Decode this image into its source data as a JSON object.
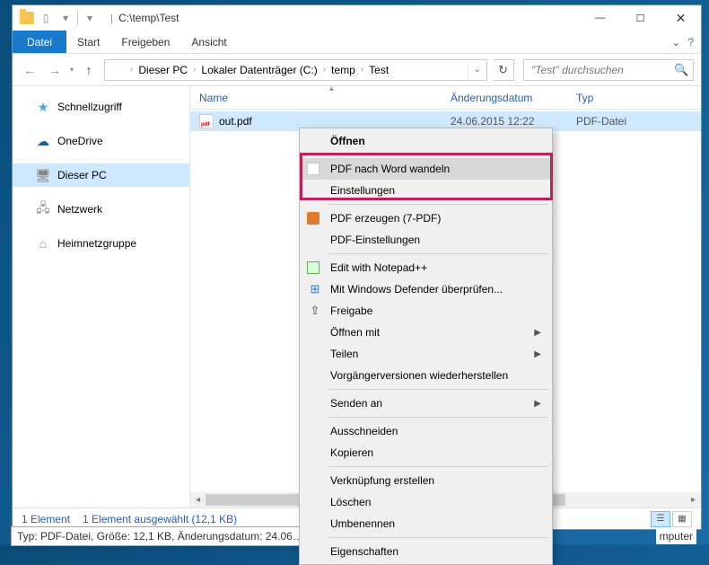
{
  "title_path": "C:\\temp\\Test",
  "ribbon": {
    "file": "Datei",
    "tabs": [
      "Start",
      "Freigeben",
      "Ansicht"
    ]
  },
  "breadcrumbs": [
    "Dieser PC",
    "Lokaler Datenträger (C:)",
    "temp",
    "Test"
  ],
  "search_placeholder": "\"Test\" durchsuchen",
  "columns": {
    "name": "Name",
    "date": "Änderungsdatum",
    "type": "Typ"
  },
  "sidebar": [
    {
      "label": "Schnellzugriff",
      "cls": "ico-star",
      "glyph": "★"
    },
    {
      "label": "OneDrive",
      "cls": "ico-onedrive",
      "glyph": "☁"
    },
    {
      "label": "Dieser PC",
      "cls": "ico-pc",
      "glyph": "🖥",
      "selected": true
    },
    {
      "label": "Netzwerk",
      "cls": "ico-net",
      "glyph": "🖧"
    },
    {
      "label": "Heimnetzgruppe",
      "cls": "ico-home",
      "glyph": "⌂"
    }
  ],
  "file": {
    "name": "out.pdf",
    "date": "24.06.2015 12:22",
    "type": "PDF-Datei"
  },
  "status": {
    "count": "1 Element",
    "selected": "1 Element ausgewählt (12,1 KB)"
  },
  "tooltip": "Typ: PDF-Datei, Größe: 12,1 KB, Änderungsdatum: 24.06…",
  "tooltip_extra": "mputer",
  "context_menu": [
    {
      "type": "item",
      "label": "Öffnen",
      "bold": true
    },
    {
      "type": "sep"
    },
    {
      "type": "item",
      "label": "PDF nach Word wandeln",
      "icon": "pdfw",
      "hover": true
    },
    {
      "type": "item",
      "label": "Einstellungen"
    },
    {
      "type": "sep"
    },
    {
      "type": "item",
      "label": "PDF erzeugen (7-PDF)",
      "icon": "orange"
    },
    {
      "type": "item",
      "label": "PDF-Einstellungen"
    },
    {
      "type": "sep"
    },
    {
      "type": "item",
      "label": "Edit with Notepad++",
      "icon": "np"
    },
    {
      "type": "item",
      "label": "Mit Windows Defender überprüfen...",
      "icon": "shield",
      "glyph": "⊞"
    },
    {
      "type": "item",
      "label": "Freigabe",
      "icon": "share",
      "glyph": "⇪"
    },
    {
      "type": "item",
      "label": "Öffnen mit",
      "submenu": true
    },
    {
      "type": "item",
      "label": "Teilen",
      "submenu": true
    },
    {
      "type": "item",
      "label": "Vorgängerversionen wiederherstellen"
    },
    {
      "type": "sep"
    },
    {
      "type": "item",
      "label": "Senden an",
      "submenu": true
    },
    {
      "type": "sep"
    },
    {
      "type": "item",
      "label": "Ausschneiden"
    },
    {
      "type": "item",
      "label": "Kopieren"
    },
    {
      "type": "sep"
    },
    {
      "type": "item",
      "label": "Verknüpfung erstellen"
    },
    {
      "type": "item",
      "label": "Löschen"
    },
    {
      "type": "item",
      "label": "Umbenennen"
    },
    {
      "type": "sep"
    },
    {
      "type": "item",
      "label": "Eigenschaften"
    }
  ]
}
